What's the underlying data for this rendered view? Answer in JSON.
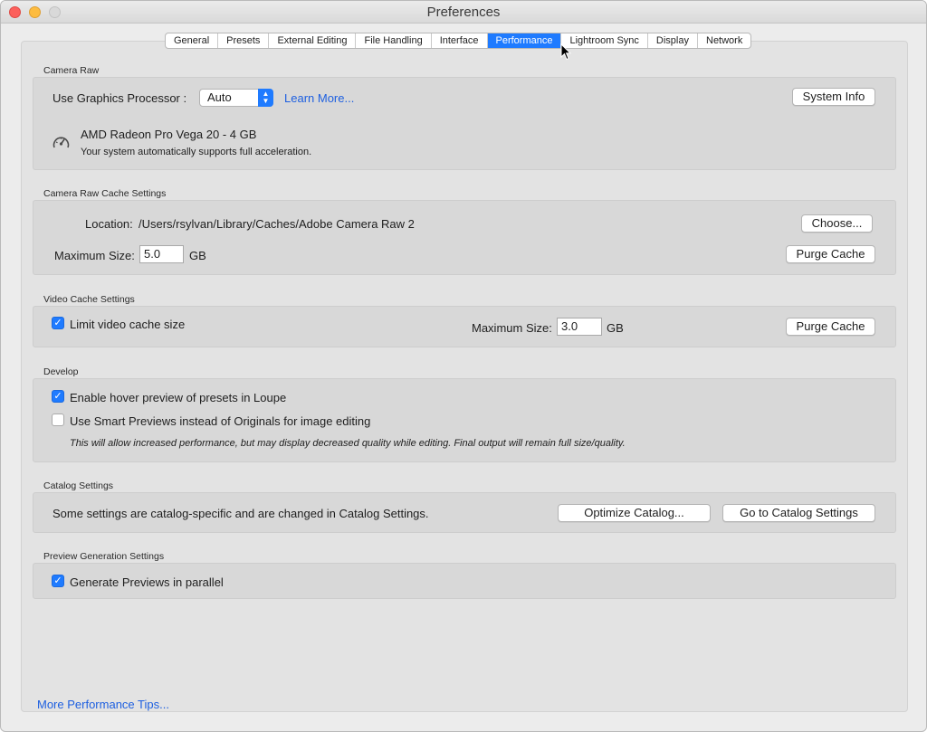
{
  "window": {
    "title": "Preferences"
  },
  "tabs": [
    {
      "label": "General"
    },
    {
      "label": "Presets"
    },
    {
      "label": "External Editing"
    },
    {
      "label": "File Handling"
    },
    {
      "label": "Interface"
    },
    {
      "label": "Performance",
      "active": true
    },
    {
      "label": "Lightroom Sync"
    },
    {
      "label": "Display"
    },
    {
      "label": "Network"
    }
  ],
  "camera_raw": {
    "section": "Camera Raw",
    "gpu_label": "Use Graphics Processor :",
    "gpu_value": "Auto",
    "learn_more": "Learn More...",
    "system_info": "System Info",
    "gpu_name": "AMD Radeon Pro Vega 20 - 4 GB",
    "gpu_status": "Your system automatically supports full acceleration."
  },
  "cache": {
    "section": "Camera Raw Cache Settings",
    "location_label": "Location:",
    "location_value": "/Users/rsylvan/Library/Caches/Adobe Camera Raw 2",
    "choose": "Choose...",
    "max_label": "Maximum Size:",
    "max_value": "5.0",
    "unit": "GB",
    "purge": "Purge Cache"
  },
  "video": {
    "section": "Video Cache Settings",
    "limit_label": "Limit video cache size",
    "limit_checked": true,
    "max_label": "Maximum Size:",
    "max_value": "3.0",
    "unit": "GB",
    "purge": "Purge Cache"
  },
  "develop": {
    "section": "Develop",
    "hover_label": "Enable hover preview of presets in Loupe",
    "hover_checked": true,
    "smart_label": "Use Smart Previews instead of Originals for image editing",
    "smart_checked": false,
    "note": "This will allow increased performance, but may display decreased quality while editing. Final output will remain full size/quality."
  },
  "catalog": {
    "section": "Catalog Settings",
    "text": "Some settings are catalog-specific and are changed in Catalog Settings.",
    "optimize": "Optimize Catalog...",
    "goto": "Go to Catalog Settings"
  },
  "preview": {
    "section": "Preview Generation Settings",
    "parallel_label": "Generate Previews in parallel",
    "parallel_checked": true
  },
  "footer": {
    "tips_link": "More Performance Tips..."
  },
  "colors": {
    "accent": "#1f7bff",
    "link": "#1d5fe0"
  }
}
